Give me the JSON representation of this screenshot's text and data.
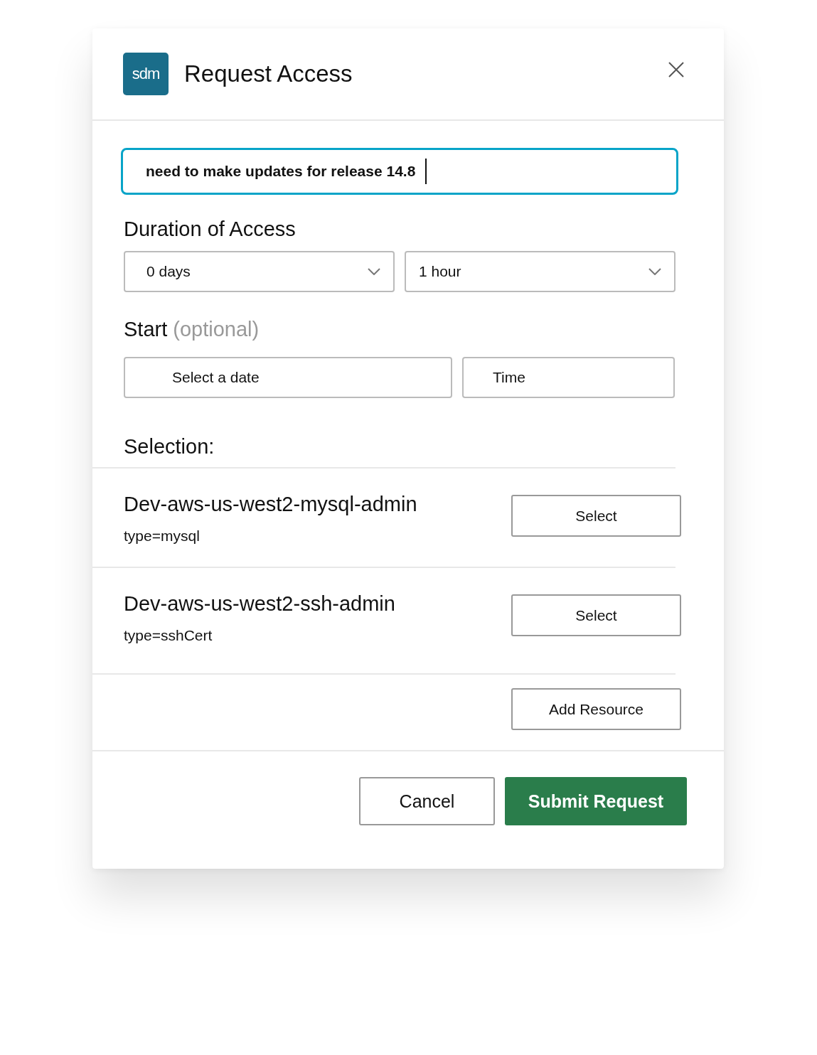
{
  "dialog": {
    "logo": "sdm",
    "title": "Request Access"
  },
  "reason": {
    "value": "need to make updates for release 14.8",
    "focused": true
  },
  "duration": {
    "label": "Duration of Access",
    "days": "0 days",
    "hours": "1 hour"
  },
  "start": {
    "label": "Start",
    "hint": "(optional)",
    "date_placeholder": "Select a date",
    "time_placeholder": "Time"
  },
  "selection": {
    "label": "Selection:",
    "resources": [
      {
        "name": "Dev-aws-us-west2-mysql-admin",
        "type": "type=mysql",
        "action": "Select"
      },
      {
        "name": "Dev-aws-us-west2-ssh-admin",
        "type": "type=sshCert",
        "action": "Select"
      }
    ],
    "add_button": "Add Resource"
  },
  "buttons": {
    "cancel": "Cancel",
    "submit": "Submit Request"
  }
}
